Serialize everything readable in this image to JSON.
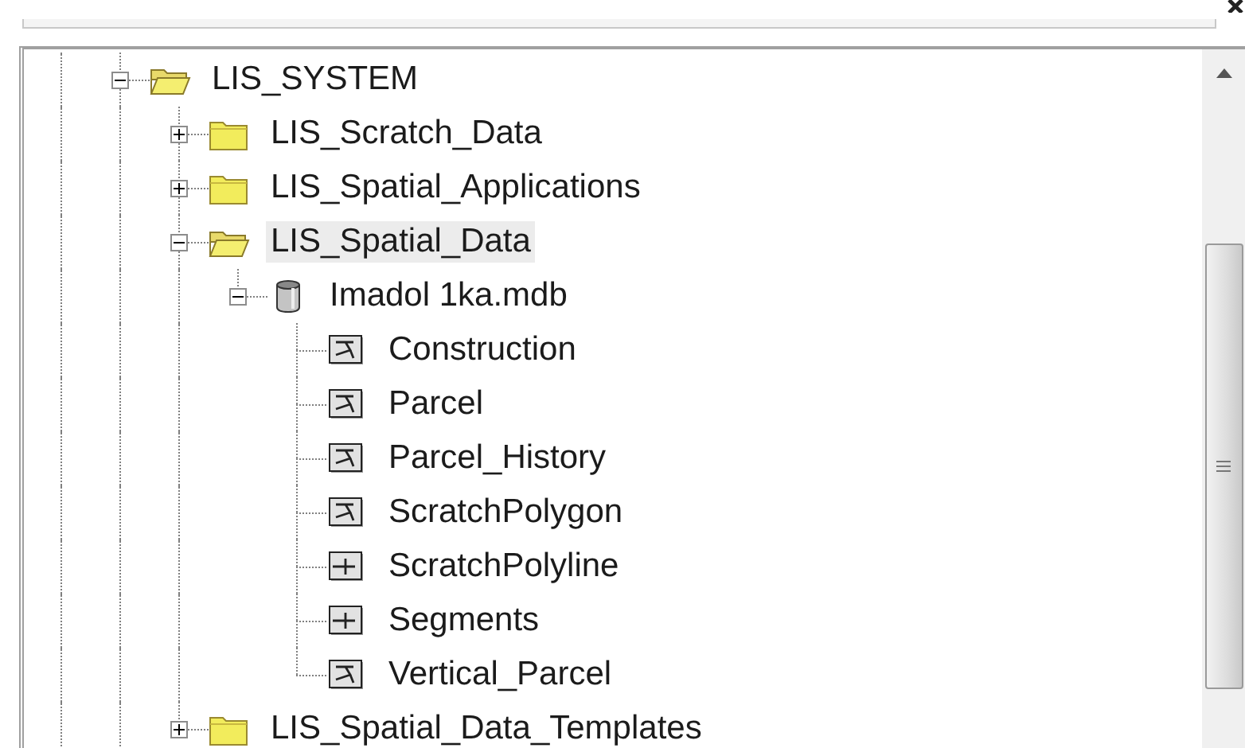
{
  "tree": {
    "items": [
      {
        "label": "LIS_SYSTEM",
        "kind": "folder",
        "expanded": true,
        "selected": false,
        "children": [
          {
            "label": "LIS_Scratch_Data",
            "kind": "folder",
            "expanded": false,
            "selected": false
          },
          {
            "label": "LIS_Spatial_Applications",
            "kind": "folder",
            "expanded": false,
            "selected": false
          },
          {
            "label": "LIS_Spatial_Data",
            "kind": "folder",
            "expanded": true,
            "selected": true,
            "children": [
              {
                "label": "Imadol 1ka.mdb",
                "kind": "database",
                "expanded": true,
                "selected": false,
                "children": [
                  {
                    "label": "Construction",
                    "kind": "polygon",
                    "selected": false
                  },
                  {
                    "label": "Parcel",
                    "kind": "polygon",
                    "selected": false
                  },
                  {
                    "label": "Parcel_History",
                    "kind": "polygon",
                    "selected": false
                  },
                  {
                    "label": "ScratchPolygon",
                    "kind": "polygon",
                    "selected": false
                  },
                  {
                    "label": "ScratchPolyline",
                    "kind": "polyline",
                    "selected": false
                  },
                  {
                    "label": "Segments",
                    "kind": "polyline",
                    "selected": false
                  },
                  {
                    "label": "Vertical_Parcel",
                    "kind": "polygon",
                    "selected": false
                  }
                ]
              }
            ]
          },
          {
            "label": "LIS_Spatial_Data_Templates",
            "kind": "folder",
            "expanded": false,
            "selected": false
          }
        ]
      }
    ]
  }
}
